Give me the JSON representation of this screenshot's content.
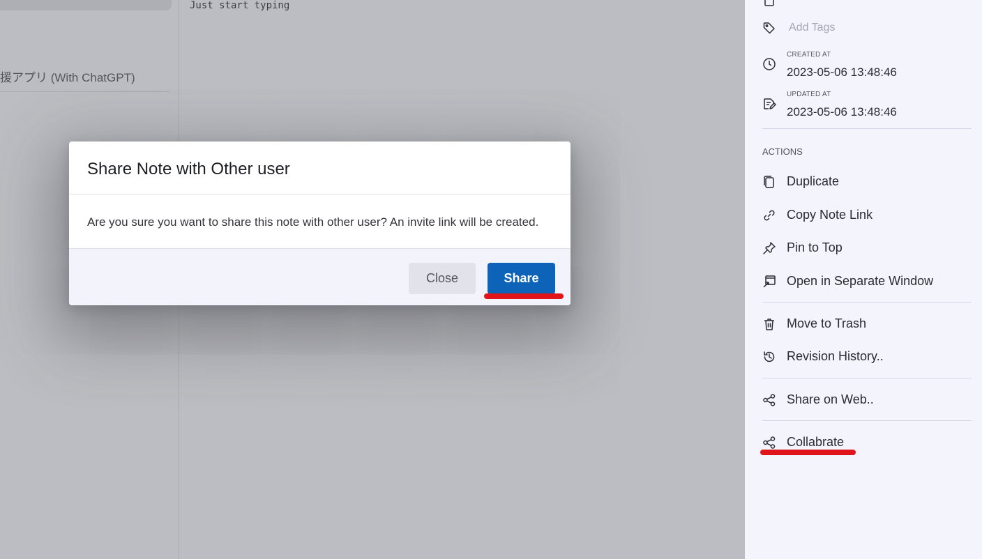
{
  "note_list": {
    "item_title": "援アプリ (With ChatGPT)"
  },
  "editor": {
    "placeholder": "Just start typing"
  },
  "sidebar": {
    "add_tags_placeholder": "Add Tags",
    "created_label": "CREATED AT",
    "created_value": "2023-05-06 13:48:46",
    "updated_label": "UPDATED AT",
    "updated_value": "2023-05-06 13:48:46",
    "actions_label": "ACTIONS",
    "actions": {
      "duplicate": "Duplicate",
      "copy_link": "Copy Note Link",
      "pin": "Pin to Top",
      "open_window": "Open in Separate Window",
      "trash": "Move to Trash",
      "revision": "Revision History..",
      "share_web": "Share on Web..",
      "collaborate": "Collabrate"
    }
  },
  "modal": {
    "title": "Share Note with Other user",
    "message": "Are you sure you want to share this note with other user? An invite link will be created.",
    "close_label": "Close",
    "share_label": "Share"
  },
  "colors": {
    "primary": "#0c63b8",
    "annotation": "#e0141b",
    "sidebar_bg": "#f4f5fc"
  }
}
